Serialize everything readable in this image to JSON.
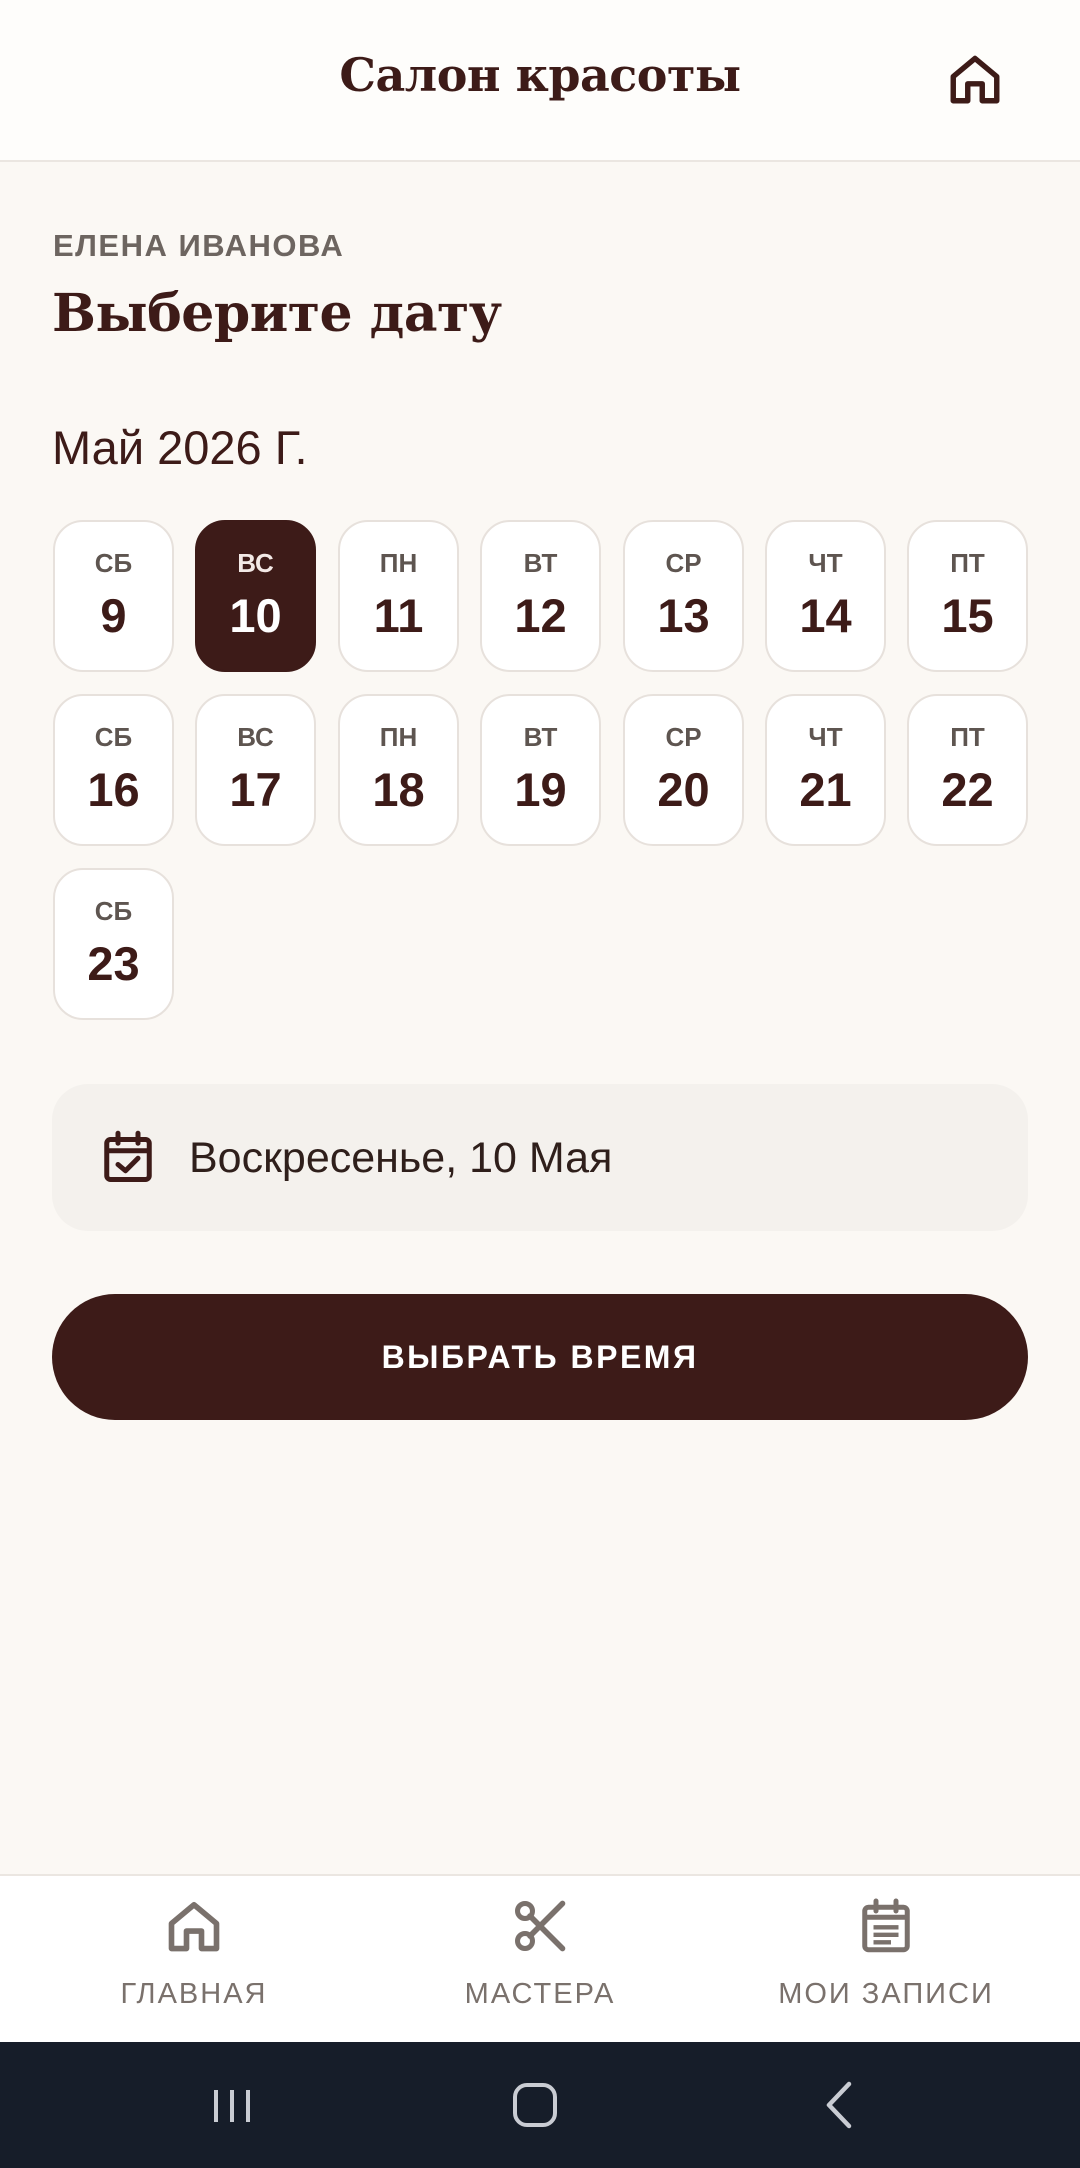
{
  "header": {
    "title": "Салон красоты",
    "home_icon": "home-icon"
  },
  "content": {
    "master_name": "ЕЛЕНА ИВАНОВА",
    "page_title": "Выберите дату",
    "month_label": "Май 2026 Г."
  },
  "days": [
    {
      "dow": "СБ",
      "num": "9",
      "selected": false
    },
    {
      "dow": "ВС",
      "num": "10",
      "selected": true
    },
    {
      "dow": "ПН",
      "num": "11",
      "selected": false
    },
    {
      "dow": "ВТ",
      "num": "12",
      "selected": false
    },
    {
      "dow": "СР",
      "num": "13",
      "selected": false
    },
    {
      "dow": "ЧТ",
      "num": "14",
      "selected": false
    },
    {
      "dow": "ПТ",
      "num": "15",
      "selected": false
    },
    {
      "dow": "СБ",
      "num": "16",
      "selected": false
    },
    {
      "dow": "ВС",
      "num": "17",
      "selected": false
    },
    {
      "dow": "ПН",
      "num": "18",
      "selected": false
    },
    {
      "dow": "ВТ",
      "num": "19",
      "selected": false
    },
    {
      "dow": "СР",
      "num": "20",
      "selected": false
    },
    {
      "dow": "ЧТ",
      "num": "21",
      "selected": false
    },
    {
      "dow": "ПТ",
      "num": "22",
      "selected": false
    },
    {
      "dow": "СБ",
      "num": "23",
      "selected": false
    }
  ],
  "selected_date": {
    "icon": "calendar-check-icon",
    "text": "Воскресенье, 10 Мая"
  },
  "cta": {
    "label": "ВЫБРАТЬ ВРЕМЯ"
  },
  "bottom_nav": {
    "items": [
      {
        "label": "ГЛАВНАЯ",
        "icon": "home-icon"
      },
      {
        "label": "МАСТЕРА",
        "icon": "scissors-icon"
      },
      {
        "label": "МОИ ЗАПИСИ",
        "icon": "calendar-list-icon"
      }
    ]
  },
  "colors": {
    "primary": "#3d1b18",
    "background": "#fbf8f4",
    "surface": "#ffffff",
    "muted_text": "#7a716c",
    "system_bar": "#161d29"
  }
}
